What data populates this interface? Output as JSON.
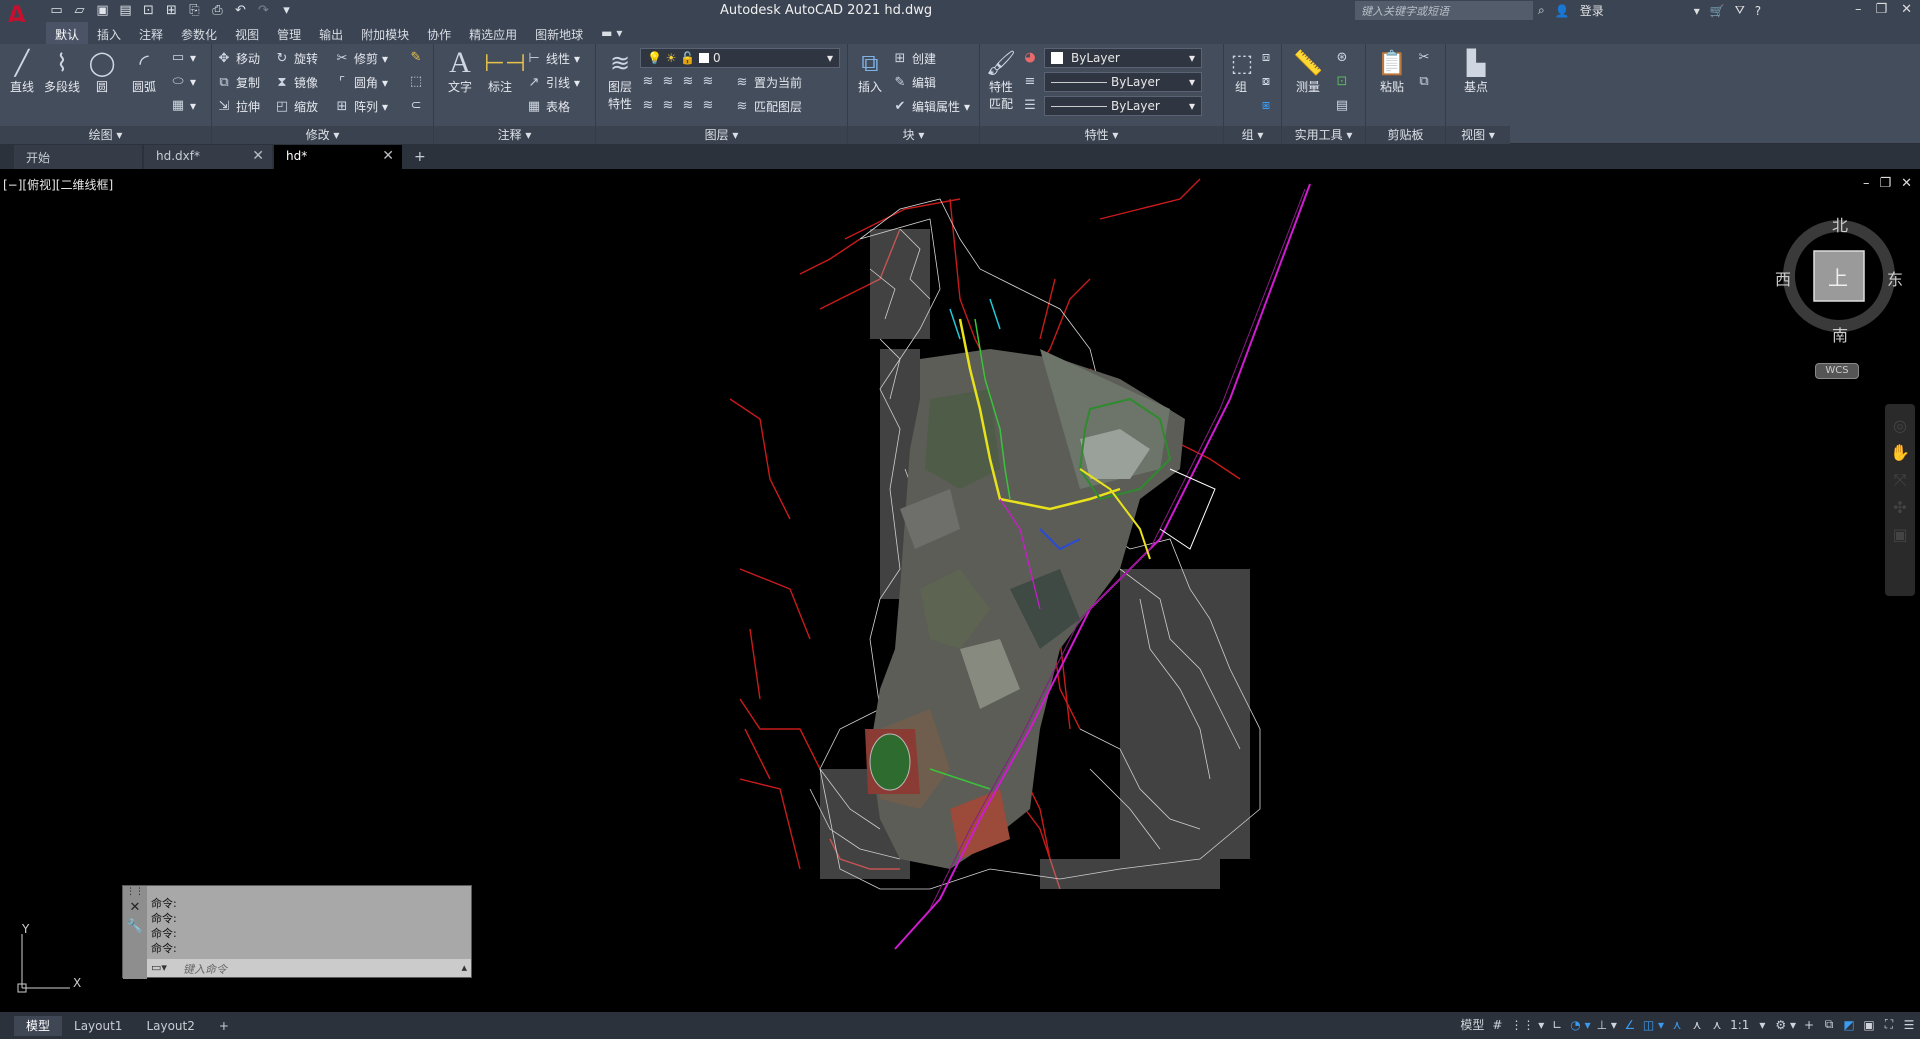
{
  "app": {
    "logo": "A",
    "title": "Autodesk AutoCAD 2021    hd.dwg",
    "search_placeholder": "键入关键字或短语",
    "login": "登录"
  },
  "ribbon_tabs": [
    "默认",
    "插入",
    "注释",
    "参数化",
    "视图",
    "管理",
    "输出",
    "附加模块",
    "协作",
    "精选应用",
    "图新地球"
  ],
  "panels": {
    "draw": {
      "label": "绘图 ▾",
      "line": "直线",
      "polyline": "多段线",
      "circle": "圆",
      "arc": "圆弧"
    },
    "modify": {
      "label": "修改 ▾",
      "move": "移动",
      "rotate": "旋转",
      "trim": "修剪",
      "copy": "复制",
      "mirror": "镜像",
      "fillet": "圆角",
      "stretch": "拉伸",
      "scale": "缩放",
      "array": "阵列"
    },
    "annotation": {
      "label": "注释 ▾",
      "text": "文字",
      "dim": "标注",
      "linear": "线性",
      "leader": "引线",
      "table": "表格"
    },
    "layers": {
      "label": "图层 ▾",
      "props_1": "图层",
      "props_2": "特性",
      "current_layer": "0",
      "set_current": "置为当前",
      "match_layer": "匹配图层"
    },
    "block": {
      "label": "块 ▾",
      "insert": "插入",
      "create": "创建",
      "edit": "编辑",
      "edit_attr": "编辑属性"
    },
    "properties": {
      "label": "特性 ▾",
      "match_1": "特性",
      "match_2": "匹配",
      "color": "ByLayer",
      "linetype": "ByLayer",
      "lineweight": "ByLayer"
    },
    "groups": {
      "label": "组 ▾",
      "group": "组"
    },
    "utilities": {
      "label": "实用工具 ▾",
      "measure": "测量"
    },
    "clipboard": {
      "label": "剪贴板",
      "paste": "粘贴"
    },
    "view": {
      "label": "视图 ▾",
      "basepoint": "基点"
    }
  },
  "doc_tabs": [
    {
      "label": "开始"
    },
    {
      "label": "hd.dxf*"
    },
    {
      "label": "hd*"
    }
  ],
  "viewport": {
    "label": "[−][俯视][二维线框]",
    "compass": {
      "north": "北",
      "south": "南",
      "east": "东",
      "west": "西",
      "top": "上"
    },
    "wcs": "WCS"
  },
  "command": {
    "lines": [
      "命令:",
      "命令:",
      "命令:",
      "命令:"
    ],
    "placeholder": "键入命令"
  },
  "ucs": {
    "x": "X",
    "y": "Y"
  },
  "layout_tabs": [
    "模型",
    "Layout1",
    "Layout2"
  ],
  "status": {
    "model": "模型",
    "scale": "1:1"
  }
}
